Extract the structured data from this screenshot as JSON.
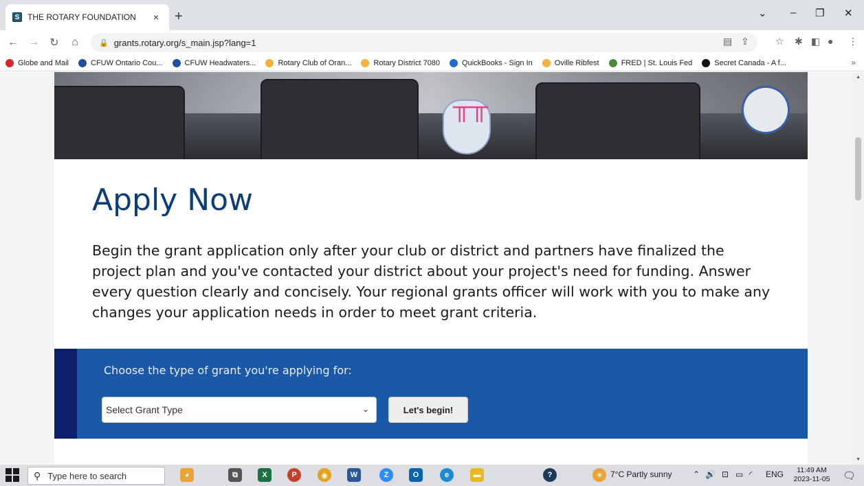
{
  "browser": {
    "tab_title": "THE ROTARY FOUNDATION",
    "tab_close": "×",
    "new_tab": "+",
    "url": "grants.rotary.org/s_main.jsp?lang=1",
    "bookmarks": [
      {
        "label": "Globe and Mail",
        "color": "#d42a2a"
      },
      {
        "label": "CFUW Ontario Cou...",
        "color": "#1e4fa0"
      },
      {
        "label": "CFUW Headwaters...",
        "color": "#1e4fa0"
      },
      {
        "label": "Rotary Club of Oran...",
        "color": "#f2b23a"
      },
      {
        "label": "Rotary District 7080",
        "color": "#f2b23a"
      },
      {
        "label": "QuickBooks - Sign In",
        "color": "#1f6fd0"
      },
      {
        "label": "Oville Ribfest",
        "color": "#f2b23a"
      },
      {
        "label": "FRED | St. Louis Fed",
        "color": "#4a8a3a"
      },
      {
        "label": "Secret Canada - A f...",
        "color": "#111111"
      }
    ],
    "bookmarks_more": "»"
  },
  "page": {
    "heading": "Apply Now",
    "intro": "Begin the grant application only after your club or district and partners have finalized the project plan and you've contacted your district about your project's need for funding. Answer every question clearly and concisely. Your regional grants officer will work with you to make any changes your application needs in order to meet grant criteria.",
    "grant_label": "Choose the type of grant you're applying for:",
    "grant_select_value": "Select Grant Type",
    "begin_button": "Let's begin!",
    "colors": {
      "heading": "#0b3d78",
      "panel": "#1b58a8",
      "panel_accent": "#0e1f6b"
    }
  },
  "taskbar": {
    "search_placeholder": "Type here to search",
    "weather": "7°C  Partly sunny",
    "lang": "ENG",
    "time": "11:49 AM",
    "date": "2023-11-05"
  }
}
